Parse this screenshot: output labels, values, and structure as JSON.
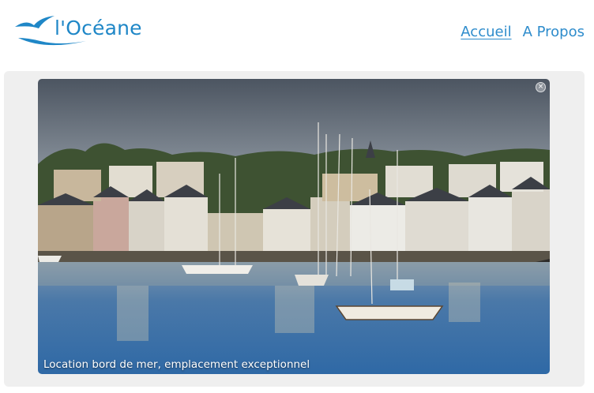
{
  "brand": {
    "name": "l'Océane",
    "color": "#1f87c7"
  },
  "nav": {
    "items": [
      {
        "label": "Accueil",
        "active": true
      },
      {
        "label": "A Propos",
        "active": false
      }
    ]
  },
  "hero": {
    "caption": "Location bord de mer, emplacement exceptionnel",
    "close_icon": "close-icon"
  }
}
